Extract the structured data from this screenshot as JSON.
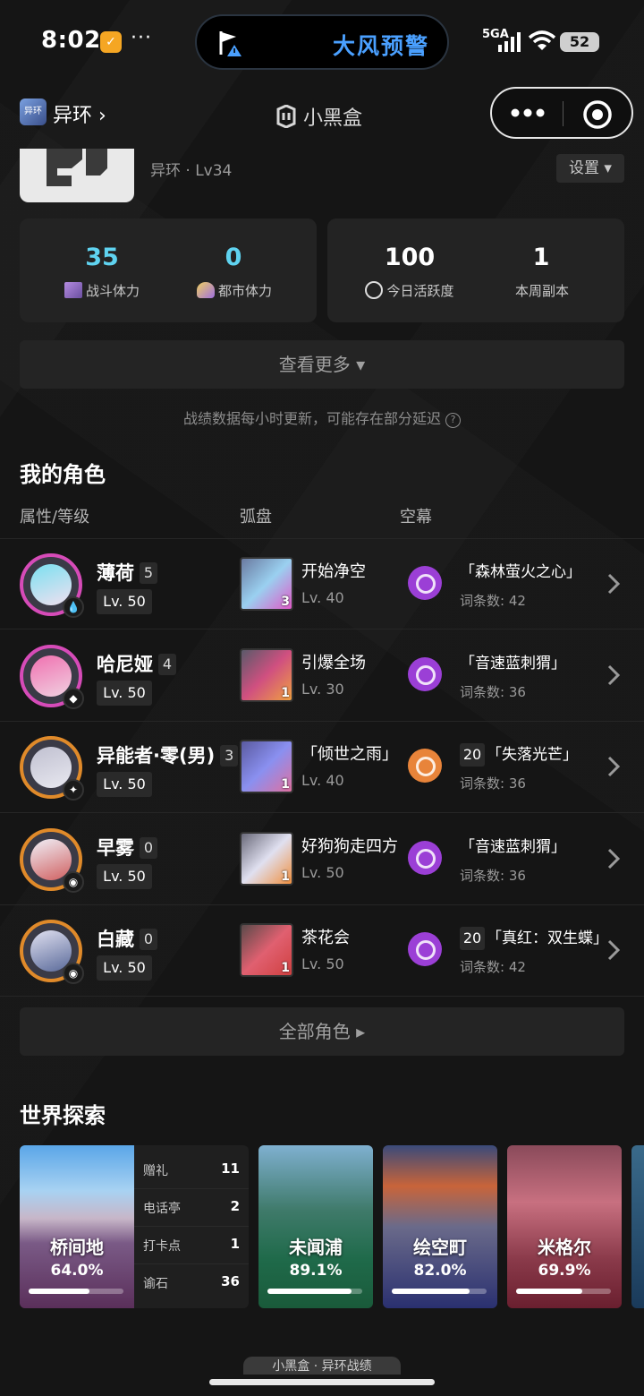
{
  "status_bar": {
    "time": "8:02",
    "more": "···",
    "network": "5GA",
    "battery": "52"
  },
  "alert": {
    "text": "大风预警"
  },
  "header": {
    "game_name": "异环",
    "game_icon_text": "异环",
    "brand": "小黑盒"
  },
  "profile": {
    "subtitle": "异环 · Lv34",
    "settings_label": "设置"
  },
  "stats": [
    {
      "value": "35",
      "label": "战斗体力"
    },
    {
      "value": "0",
      "label": "都市体力"
    },
    {
      "value": "100",
      "label": "今日活跃度"
    },
    {
      "value": "1",
      "label": "本周副本"
    }
  ],
  "more_label": "查看更多",
  "note": "战绩数据每小时更新，可能存在部分延迟",
  "characters_section": {
    "title": "我的角色",
    "col_attr": "属性/等级",
    "col_disc": "弧盘",
    "col_void": "空幕",
    "rows": [
      {
        "name": "薄荷",
        "rank": "5",
        "level": "Lv. 50",
        "disc_name": "开始净空",
        "disc_num": "3",
        "disc_level": "Lv. 40",
        "void_badge": "",
        "void_name": "「森林萤火之心」",
        "void_count": "词条数: 42",
        "ring_color": "#d64bb8",
        "void_color": "#9b3fd6"
      },
      {
        "name": "哈尼娅",
        "rank": "4",
        "level": "Lv. 50",
        "disc_name": "引爆全场",
        "disc_num": "1",
        "disc_level": "Lv. 30",
        "void_badge": "",
        "void_name": "「音速蓝刺猬」",
        "void_count": "词条数: 36",
        "ring_color": "#d64bb8",
        "void_color": "#9b3fd6"
      },
      {
        "name": "异能者·零(男)",
        "rank": "3",
        "level": "Lv. 50",
        "disc_name": "「倾世之雨」",
        "disc_num": "1",
        "disc_level": "Lv. 40",
        "void_badge": "20",
        "void_name": "「失落光芒」",
        "void_count": "词条数: 36",
        "ring_color": "#e08a2a",
        "void_color": "#e8843a"
      },
      {
        "name": "早雾",
        "rank": "0",
        "level": "Lv. 50",
        "disc_name": "好狗狗走四方",
        "disc_num": "1",
        "disc_level": "Lv. 50",
        "void_badge": "",
        "void_name": "「音速蓝刺猬」",
        "void_count": "词条数: 36",
        "ring_color": "#e08a2a",
        "void_color": "#9b3fd6"
      },
      {
        "name": "白藏",
        "rank": "0",
        "level": "Lv. 50",
        "disc_name": "茶花会",
        "disc_num": "1",
        "disc_level": "Lv. 50",
        "void_badge": "20",
        "void_name": "「真红：双生蝶」",
        "void_count": "词条数: 42",
        "ring_color": "#e08a2a",
        "void_color": "#9b3fd6"
      }
    ],
    "all_label": "全部角色"
  },
  "world": {
    "title": "世界探索",
    "main": {
      "name": "桥间地",
      "percent": "64.0%",
      "progress": 0.64,
      "items": [
        {
          "label": "赠礼",
          "value": "11"
        },
        {
          "label": "电话亭",
          "value": "2"
        },
        {
          "label": "打卡点",
          "value": "1"
        },
        {
          "label": "谕石",
          "value": "36"
        }
      ]
    },
    "areas": [
      {
        "name": "未闻浦",
        "percent": "89.1%",
        "progress": 0.891
      },
      {
        "name": "绘空町",
        "percent": "82.0%",
        "progress": 0.82
      },
      {
        "name": "米格尔",
        "percent": "69.9%",
        "progress": 0.699
      }
    ]
  },
  "footer": {
    "text": "小黑盒 · 异环战绩"
  }
}
